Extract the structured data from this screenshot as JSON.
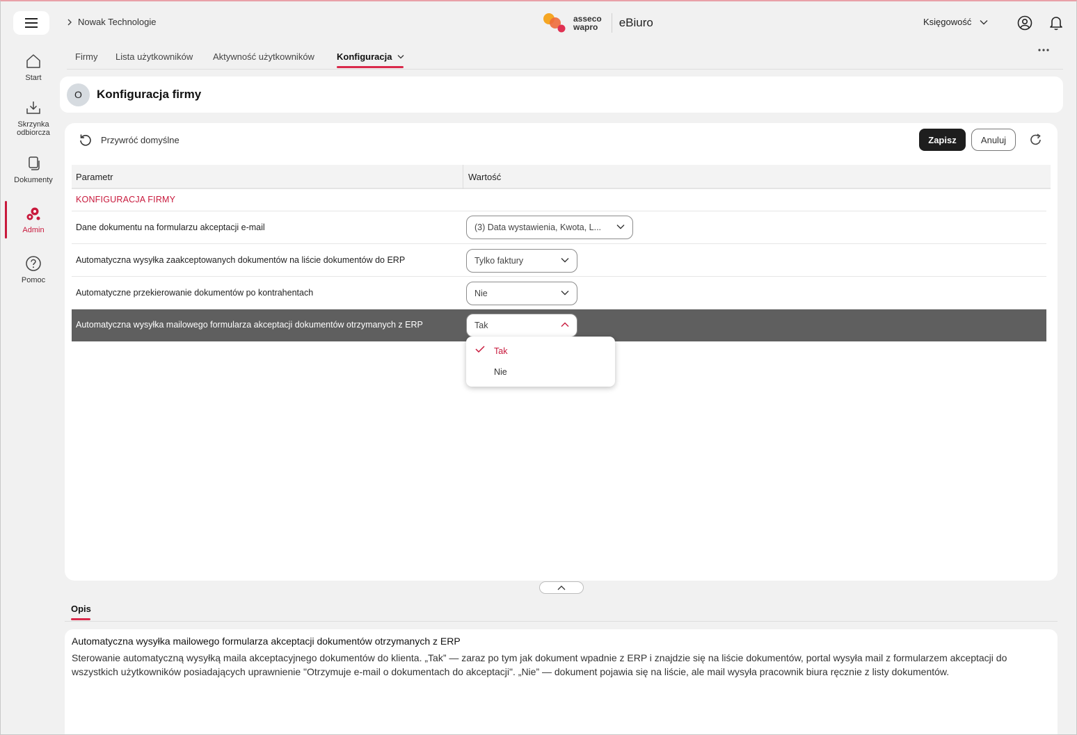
{
  "header": {
    "breadcrumb": "Nowak Technologie",
    "logo_line1": "asseco",
    "logo_line2": "wapro",
    "app_name": "eBiuro",
    "role": "Księgowość"
  },
  "sidebar": {
    "items": [
      {
        "label": "Start",
        "icon": "home-icon"
      },
      {
        "label": "Skrzynka",
        "label2": "odbiorcza",
        "icon": "inbox-download-icon"
      },
      {
        "label": "Dokumenty",
        "icon": "documents-icon"
      },
      {
        "label": "Admin",
        "icon": "gears-icon"
      },
      {
        "label": "Pomoc",
        "icon": "help-icon"
      }
    ]
  },
  "tabs": [
    "Firmy",
    "Lista użytkowników",
    "Aktywność użytkowników",
    "Konfiguracja"
  ],
  "page": {
    "avatar": "O",
    "title": "Konfiguracja firmy"
  },
  "toolbar": {
    "restore_label": "Przywróć domyślne",
    "save_label": "Zapisz",
    "cancel_label": "Anuluj"
  },
  "table": {
    "col_param": "Parametr",
    "col_value": "Wartość",
    "section": "KONFIGURACJA FIRMY",
    "rows": [
      {
        "name": "Dane dokumentu na formularzu akceptacji e-mail",
        "value": "(3) Data wystawienia, Kwota, L..."
      },
      {
        "name": "Automatyczna wysyłka zaakceptowanych dokumentów na liście dokumentów do ERP",
        "value": "Tylko faktury"
      },
      {
        "name": "Automatyczne przekierowanie dokumentów po kontrahentach",
        "value": "Nie"
      },
      {
        "name": "Automatyczna wysyłka mailowego formularza akceptacji dokumentów otrzymanych z ERP",
        "value": "Tak"
      }
    ]
  },
  "dropdown": {
    "options": [
      "Tak",
      "Nie"
    ],
    "selected": "Tak"
  },
  "description": {
    "tab": "Opis",
    "title": "Automatyczna wysyłka mailowego formularza akceptacji dokumentów otrzymanych z ERP",
    "text": "Sterowanie automatyczną wysyłką maila akceptacyjnego dokumentów do klienta. „Tak” — zaraz po tym jak dokument wpadnie z ERP i znajdzie się na liście dokumentów, portal wysyła mail z formularzem akceptacji do wszystkich użytkowników posiadających uprawnienie \"Otrzymuje e-mail o dokumentach do akceptacji\". „Nie” — dokument pojawia się na liście, ale mail wysyła pracownik biura ręcznie z listy dokumentów."
  },
  "colors": {
    "accent": "#c8193c",
    "selected_row": "#5f5f5f",
    "save_button": "#1e1e1e"
  }
}
